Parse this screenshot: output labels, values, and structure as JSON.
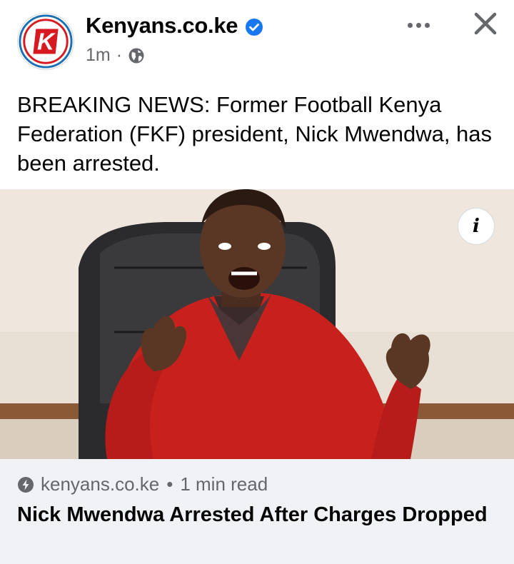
{
  "post": {
    "page_name": "Kenyans.co.ke",
    "avatar_letter": "K",
    "time": "1m",
    "separator": "·",
    "text": "BREAKING NEWS: Former Football Kenya Federation (FKF) president, Nick Mwendwa, has been arrested."
  },
  "icons": {
    "verified": "verified-badge-icon",
    "audience": "globe-icon",
    "more": "more-options-icon",
    "close": "close-icon",
    "info": "info-icon",
    "instant": "lightning-bolt-icon"
  },
  "media": {
    "info_label": "i"
  },
  "link_preview": {
    "domain": "kenyans.co.ke",
    "separator": "•",
    "read_time": "1 min read",
    "title": "Nick Mwendwa Arrested After Charges Dropped"
  },
  "colors": {
    "brand_red": "#d71920",
    "brand_blue": "#1c6fb4",
    "verified_blue": "#1877f2",
    "secondary_text": "#65676b",
    "preview_bg": "#f0f2f5"
  }
}
